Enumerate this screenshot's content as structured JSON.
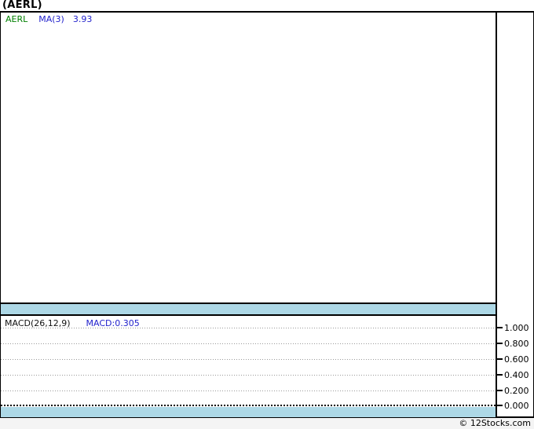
{
  "header": {
    "title": "(AERL)"
  },
  "price_panel": {
    "legend": {
      "symbol": "AERL",
      "ma_label": "MA(3)",
      "ma_value": "3.93"
    }
  },
  "macd_panel": {
    "indicator_label": "MACD(26,12,9)",
    "value_label": "MACD:0.305",
    "y_ticks": [
      "1.000",
      "0.800",
      "0.600",
      "0.400",
      "0.200",
      "0.000"
    ]
  },
  "footer": {
    "credit": "© 12Stocks.com"
  },
  "colors": {
    "separator_band": "#ADD8E6",
    "symbol_green": "#008000",
    "indicator_blue": "#2222CC",
    "grid_dotted_gray": "#999999",
    "border_black": "#000000",
    "footer_bg": "#F4F4F4"
  },
  "chart_data": [
    {
      "type": "line",
      "title": "AERL price panel with MA(3)",
      "legend_position": "top-left",
      "series": [
        {
          "name": "AERL",
          "color": "#008000",
          "x": [],
          "y": []
        },
        {
          "name": "MA(3)",
          "color": "#2222CC",
          "x": [],
          "y": [],
          "last_value": 3.93
        }
      ],
      "grid": false,
      "note": "panel is empty white; no plotted price/MA points visible in the pixels"
    },
    {
      "type": "line",
      "title": "MACD(26,12,9)",
      "legend_position": "top-left",
      "series": [
        {
          "name": "MACD",
          "color": "#2222CC",
          "x": [],
          "y": [],
          "last_value": 0.305
        }
      ],
      "ylim": [
        -0.15,
        1.15
      ],
      "yticks": [
        0.0,
        0.2,
        0.4,
        0.6,
        0.8,
        1.0
      ],
      "grid": true,
      "zero_line": true,
      "note": "only dotted gridlines, dense dotted zero line and axis labels visible; no plotted MACD curve"
    }
  ]
}
